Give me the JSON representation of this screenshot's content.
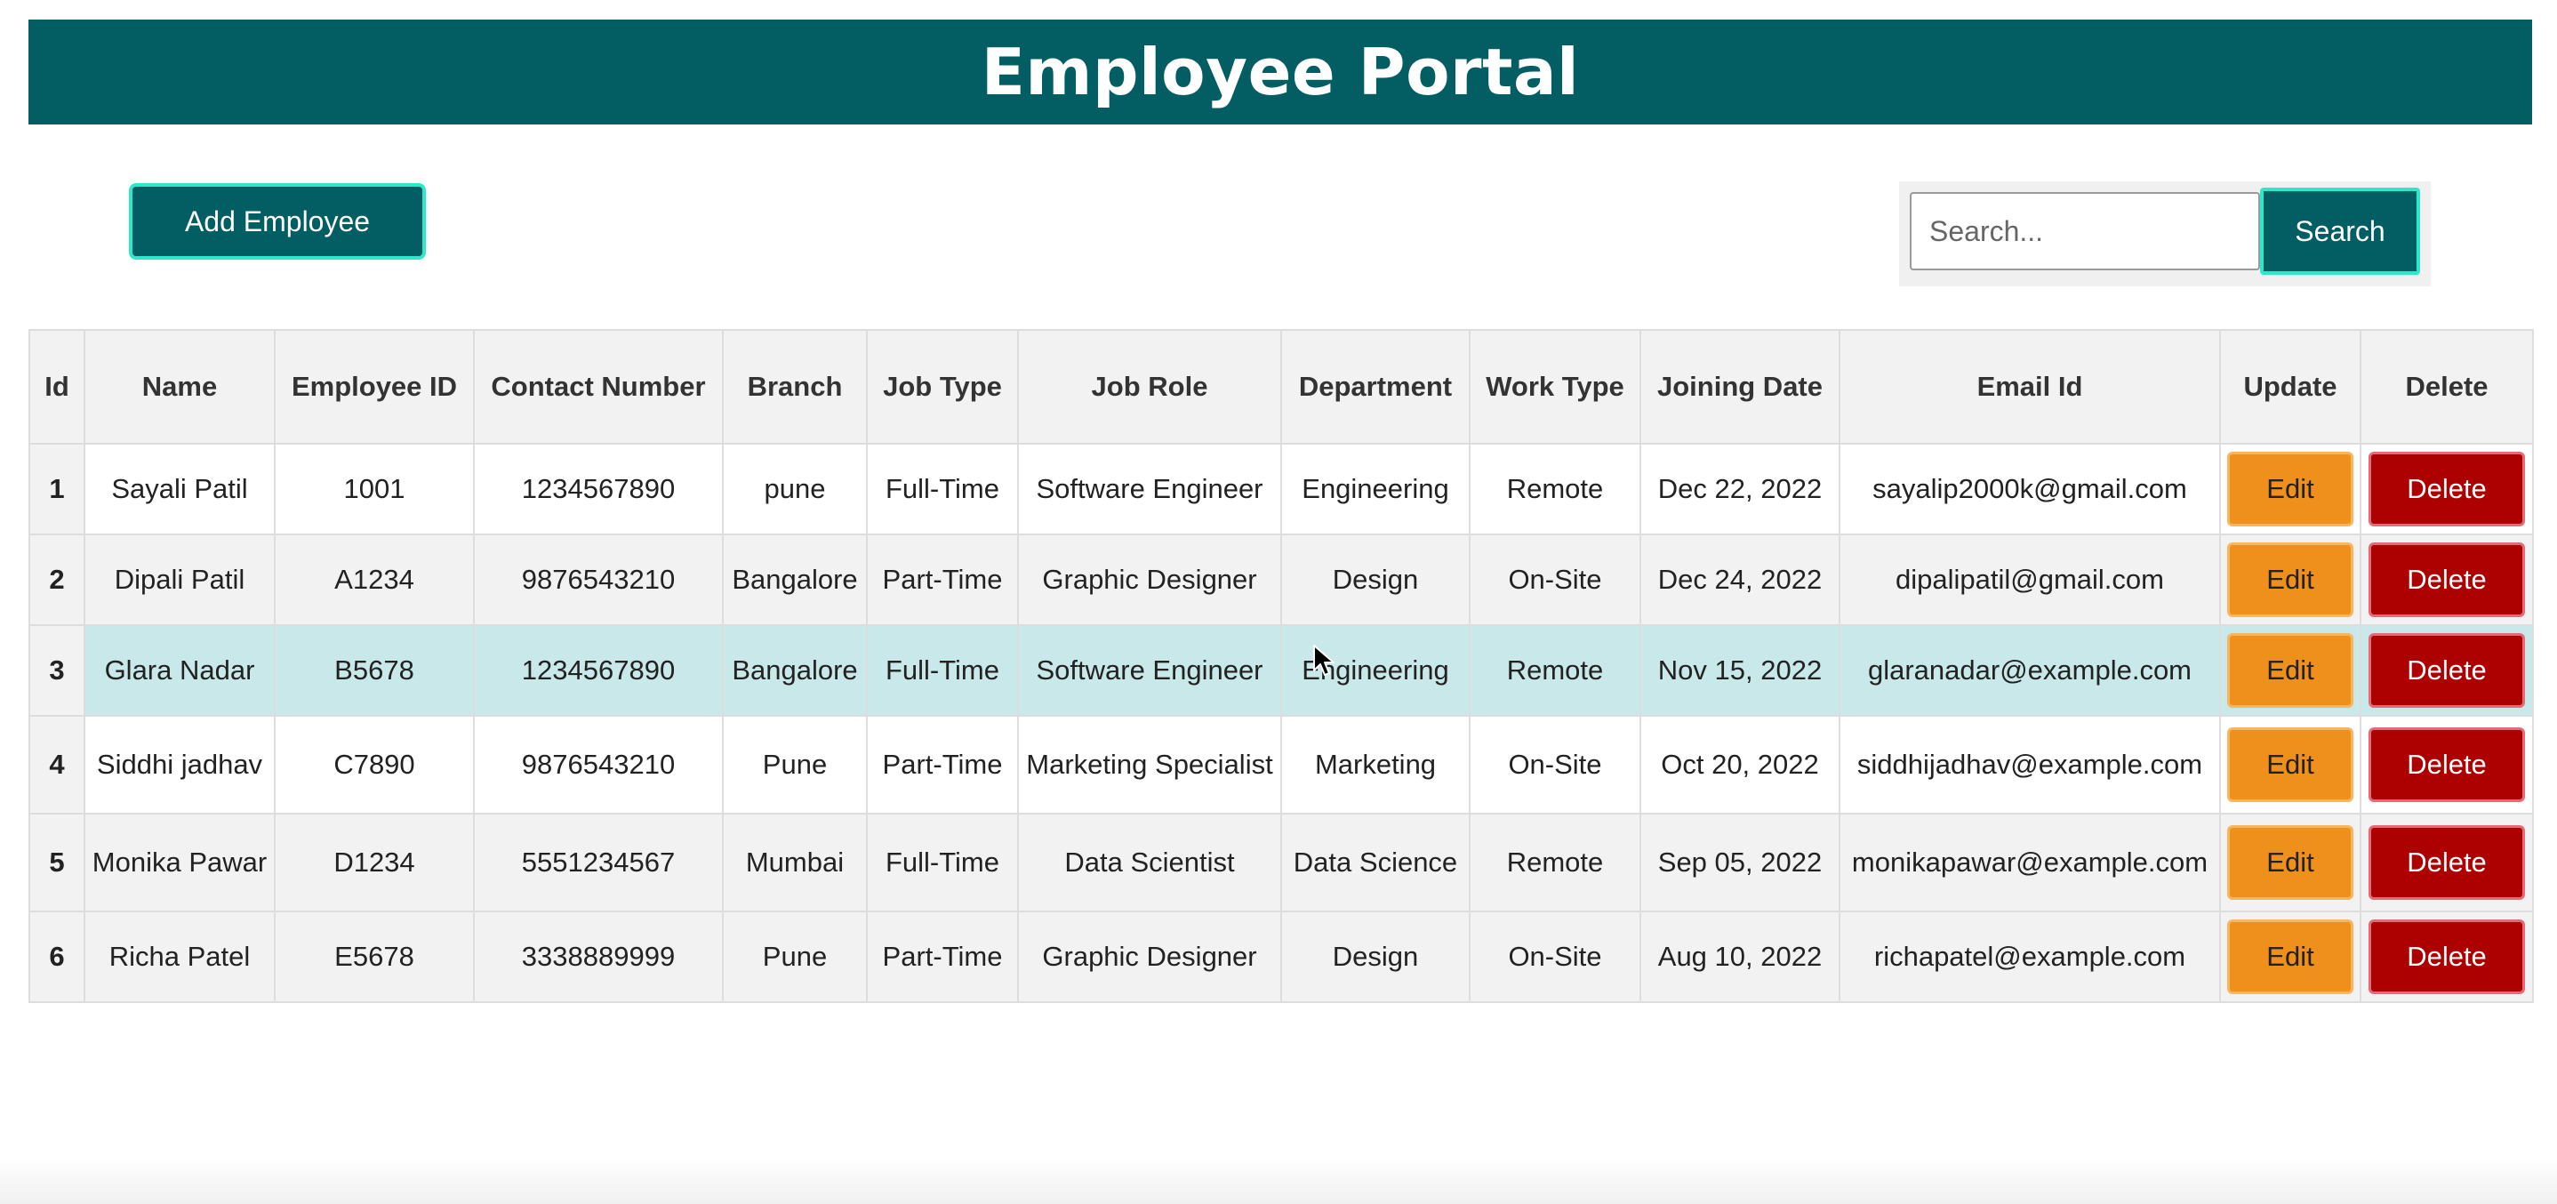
{
  "header": {
    "title": "Employee Portal"
  },
  "toolbar": {
    "add_label": "Add Employee",
    "search_placeholder": "Search...",
    "search_value": "",
    "search_label": "Search"
  },
  "colors": {
    "primary": "#025e63",
    "accent_border": "#2ee6c9",
    "edit": "#f0901c",
    "delete": "#ad0000",
    "highlight_row": "#c8e8ea"
  },
  "table": {
    "columns": [
      "Id",
      "Name",
      "Employee ID",
      "Contact Number",
      "Branch",
      "Job Type",
      "Job Role",
      "Department",
      "Work Type",
      "Joining Date",
      "Email Id",
      "Update",
      "Delete"
    ],
    "rows": [
      {
        "id": "1",
        "name": "Sayali Patil",
        "employee_id": "1001",
        "contact": "1234567890",
        "branch": "pune",
        "job_type": "Full-Time",
        "job_role": "Software Engineer",
        "department": "Engineering",
        "work_type": "Remote",
        "joining_date": "Dec 22, 2022",
        "email": "sayalip2000k@gmail.com",
        "edit_label": "Edit",
        "delete_label": "Delete"
      },
      {
        "id": "2",
        "name": "Dipali Patil",
        "employee_id": "A1234",
        "contact": "9876543210",
        "branch": "Bangalore",
        "job_type": "Part-Time",
        "job_role": "Graphic Designer",
        "department": "Design",
        "work_type": "On-Site",
        "joining_date": "Dec 24, 2022",
        "email": "dipalipatil@gmail.com",
        "edit_label": "Edit",
        "delete_label": "Delete"
      },
      {
        "id": "3",
        "name": "Glara Nadar",
        "employee_id": "B5678",
        "contact": "1234567890",
        "branch": "Bangalore",
        "job_type": "Full-Time",
        "job_role": "Software Engineer",
        "department": "Engineering",
        "work_type": "Remote",
        "joining_date": "Nov 15, 2022",
        "email": "glaranadar@example.com",
        "edit_label": "Edit",
        "delete_label": "Delete"
      },
      {
        "id": "4",
        "name": "Siddhi jadhav",
        "employee_id": "C7890",
        "contact": "9876543210",
        "branch": "Pune",
        "job_type": "Part-Time",
        "job_role": "Marketing Specialist",
        "department": "Marketing",
        "work_type": "On-Site",
        "joining_date": "Oct 20, 2022",
        "email": "siddhijadhav@example.com",
        "edit_label": "Edit",
        "delete_label": "Delete"
      },
      {
        "id": "5",
        "name": "Monika Pawar",
        "employee_id": "D1234",
        "contact": "5551234567",
        "branch": "Mumbai",
        "job_type": "Full-Time",
        "job_role": "Data Scientist",
        "department": "Data Science",
        "work_type": "Remote",
        "joining_date": "Sep 05, 2022",
        "email": "monikapawar@example.com",
        "edit_label": "Edit",
        "delete_label": "Delete"
      },
      {
        "id": "6",
        "name": "Richa Patel",
        "employee_id": "E5678",
        "contact": "3338889999",
        "branch": "Pune",
        "job_type": "Part-Time",
        "job_role": "Graphic Designer",
        "department": "Design",
        "work_type": "On-Site",
        "joining_date": "Aug 10, 2022",
        "email": "richapatel@example.com",
        "edit_label": "Edit",
        "delete_label": "Delete"
      }
    ]
  }
}
